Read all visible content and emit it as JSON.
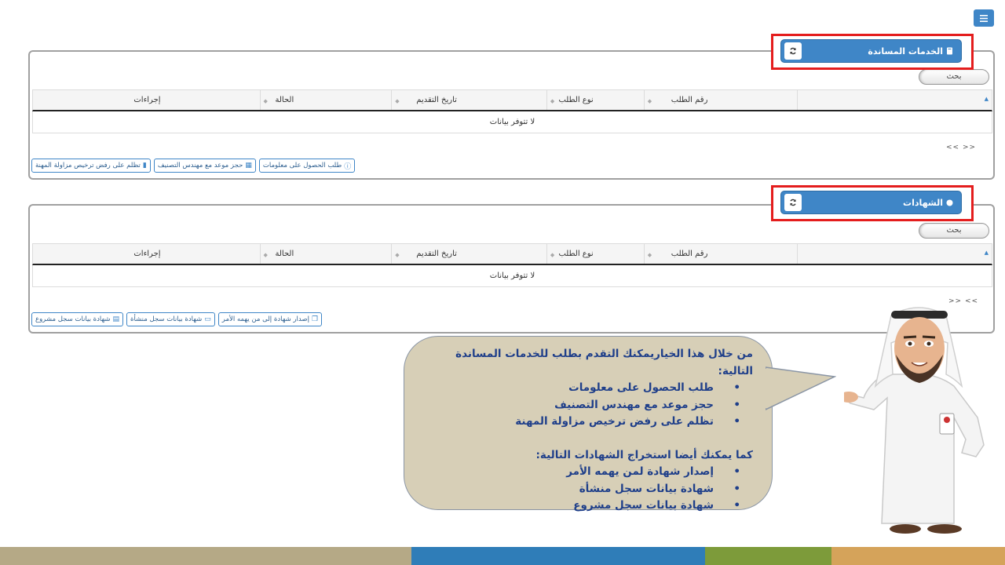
{
  "menu": {
    "icon": "hamburger-icon"
  },
  "panels": [
    {
      "title": "الخدمات المساندة",
      "title_icon": "book-icon",
      "search_label": "بحث",
      "columns": [
        "رقم الطلب",
        "نوع الطلب",
        "تاريخ التقديم",
        "الحالة",
        "إجراءات"
      ],
      "empty_text": "لا تتوفر بيانات",
      "pager": "<< >>",
      "actions": [
        {
          "label": "طلب الحصول على معلومات",
          "icon": "info-icon"
        },
        {
          "label": "حجز موعد مع مهندس التصنيف",
          "icon": "calendar-icon"
        },
        {
          "label": "تظلم على رفض ترخيص مزاولة المهنة",
          "icon": "file-icon"
        }
      ]
    },
    {
      "title": "الشهادات",
      "title_icon": "circle-icon",
      "search_label": "بحث",
      "columns": [
        "رقم الطلب",
        "نوع الطلب",
        "تاريخ التقديم",
        "الحالة",
        "إجراءات"
      ],
      "empty_text": "لا تتوفر بيانات",
      "pager": ">> <<",
      "actions": [
        {
          "label": "إصدار شهادة إلى من يهمه الأمر",
          "icon": "copy-icon"
        },
        {
          "label": "شهادة بيانات سجل منشأة",
          "icon": "inbox-icon"
        },
        {
          "label": "شهادة بيانات سجل مشروع",
          "icon": "table-icon"
        }
      ]
    }
  ],
  "bubble": {
    "intro": "من خلال هذا الخياريمكنك التقدم بطلب للخدمات المساندة التالية:",
    "services": [
      "طلب الحصول على معلومات",
      "حجز موعد مع مهندس التصنيف",
      "تظلم على رفض ترخيص مزاولة المهنة"
    ],
    "intro2": "كما يمكنك أيضا استخراج الشهادات التالية:",
    "certificates": [
      "إصدار شهادة لمن يهمه الأمر",
      "شهادة بيانات سجل منشأة",
      "شهادة بيانات سجل مشروع"
    ]
  },
  "colors": {
    "primary": "#3f86c7",
    "highlight": "#e41d1d",
    "bubble": "#d7cfb7",
    "bubble_text": "#1f3f8a",
    "footer": [
      "#b5a986",
      "#2f7db8",
      "#7d9b3a",
      "#d5a35a"
    ]
  }
}
